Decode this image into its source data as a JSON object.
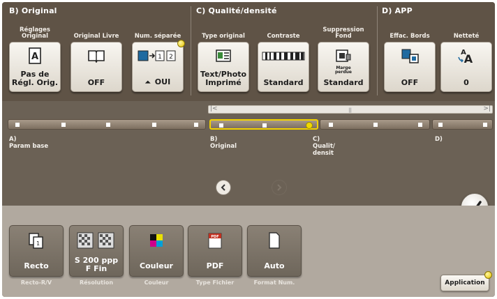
{
  "sections": {
    "original": {
      "title": "B)  Original"
    },
    "quality": {
      "title": "C)  Qualité/densité"
    },
    "app": {
      "title": "D)  APP"
    }
  },
  "tiles": [
    {
      "label": "Réglages\nOriginal",
      "value": "Pas de\nRégl. Orig.",
      "icon": "document-a-icon"
    },
    {
      "label": "Original Livre",
      "value": "OFF",
      "icon": "open-book-icon"
    },
    {
      "label": "Num. séparée",
      "value": "OUI",
      "icon": "separate-scan-icon"
    },
    {
      "label": "Type original",
      "value": "Text/Photo\nImprimé",
      "icon": "text-photo-icon"
    },
    {
      "label": "Contraste",
      "value": "Standard",
      "icon": "contrast-icon"
    },
    {
      "label": "Suppression\nFond",
      "sublabel": "Marge\nperdue",
      "value": "Standard",
      "icon": "background-removal-icon"
    },
    {
      "label": "Effac. Bords",
      "value": "OFF",
      "icon": "frame-erase-icon"
    },
    {
      "label": "Netteté",
      "value": "0",
      "icon": "sharpness-icon"
    }
  ],
  "nav": {
    "labels": [
      "A)\nParam base",
      "B)\nOriginal",
      "C)\nQualit/\ndensit",
      "D)"
    ]
  },
  "bottom_tiles": [
    {
      "value": "Recto",
      "caption": "Recto-R/V",
      "icon": "simplex-icon"
    },
    {
      "value": "S 200 ppp\nF Fin",
      "caption": "Résolution",
      "icon": "resolution-icon"
    },
    {
      "value": "Couleur",
      "caption": "Couleur",
      "icon": "color-icon"
    },
    {
      "value": "PDF",
      "caption": "Type Fichier",
      "icon": "pdf-icon"
    },
    {
      "value": "Auto",
      "caption": "Format Num.",
      "icon": "scan-size-icon"
    }
  ],
  "application_button": "Application",
  "colors": {
    "accent": "#f0d800",
    "panel": "#5f5346",
    "bottom": "#b1a99f"
  }
}
